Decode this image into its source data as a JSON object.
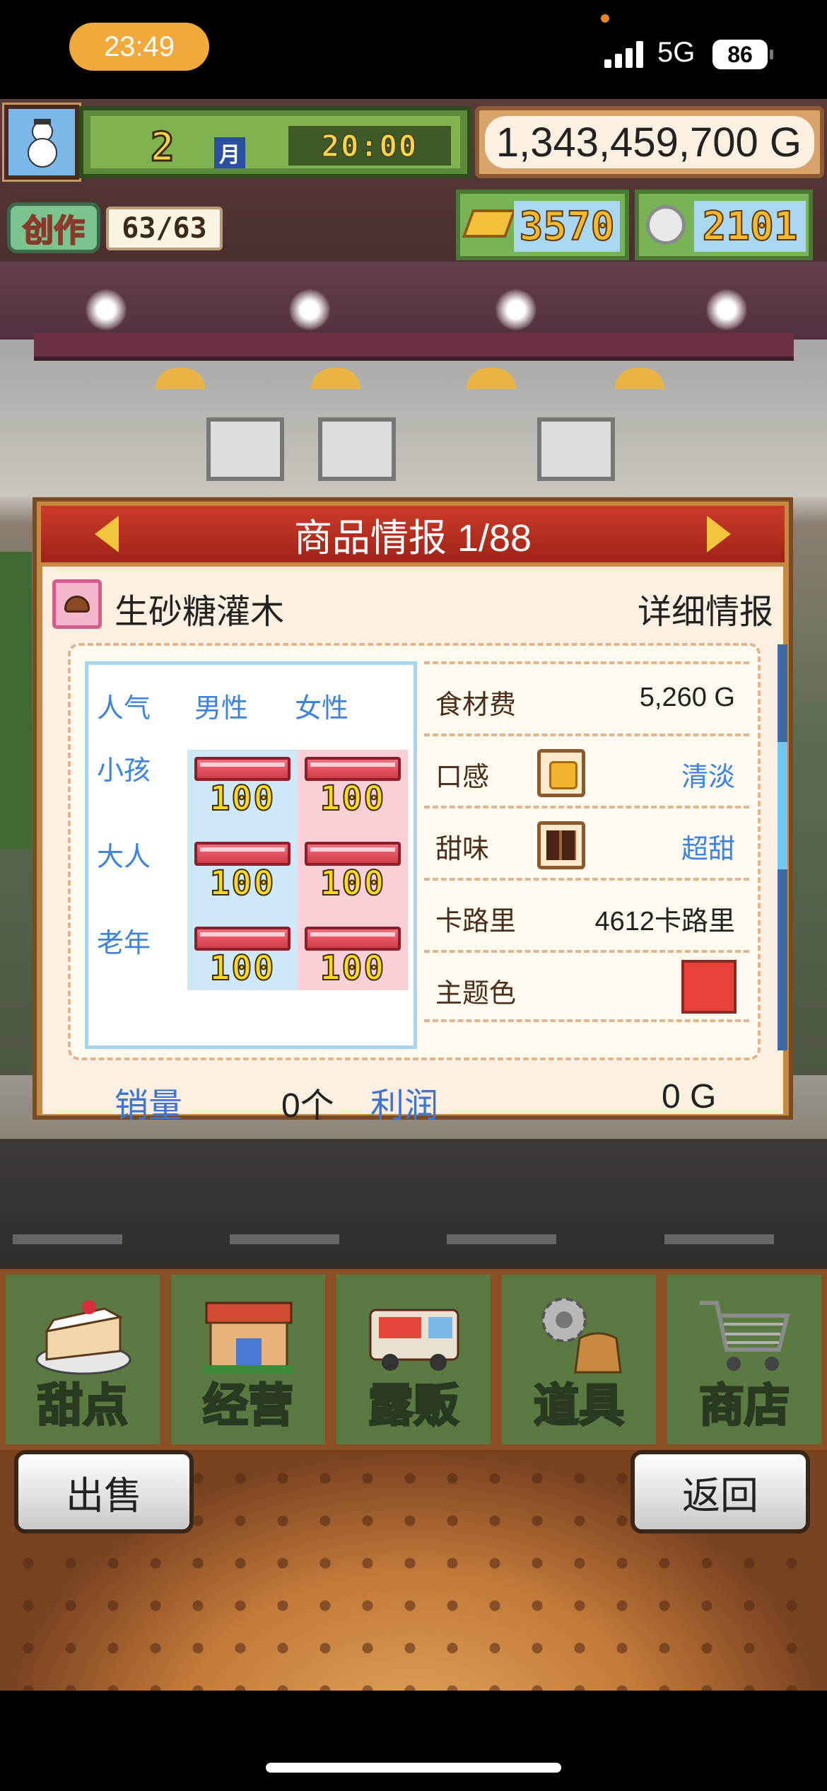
{
  "status_bar": {
    "time": "23:49",
    "network": "5G",
    "battery": "86"
  },
  "hud": {
    "month_number": "2",
    "month_unit": "月",
    "clock": "20:00",
    "money": "1,343,459,700 G",
    "create_label": "创作",
    "create_value": "63/63",
    "gold_bars": "3570",
    "silver_coins": "2101"
  },
  "panel": {
    "title": "商品情报 1/88",
    "item_name": "生砂糖灌木",
    "detail_button": "详细情报",
    "popularity": {
      "header": "人气",
      "col_male": "男性",
      "col_female": "女性",
      "rows": [
        {
          "label": "小孩",
          "male": "100",
          "female": "100"
        },
        {
          "label": "大人",
          "male": "100",
          "female": "100"
        },
        {
          "label": "老年",
          "male": "100",
          "female": "100"
        }
      ]
    },
    "attributes": {
      "ingredient_cost_label": "食材费",
      "ingredient_cost_value": "5,260 G",
      "texture_label": "口感",
      "texture_value": "清淡",
      "sweetness_label": "甜味",
      "sweetness_value": "超甜",
      "calories_label": "卡路里",
      "calories_value": "4612卡路里",
      "theme_color_label": "主题色",
      "theme_color": "#e8423a"
    },
    "stats": {
      "sales_label": "销量",
      "sales_value": "0个",
      "profit_label": "利润",
      "profit_value": "0 G"
    },
    "scroll_position": 0.35
  },
  "menu": {
    "items": [
      {
        "label": "甜点",
        "icon": "cake-icon"
      },
      {
        "label": "经营",
        "icon": "shop-icon"
      },
      {
        "label": "露贩",
        "icon": "food-truck-icon"
      },
      {
        "label": "道具",
        "icon": "gear-and-bag-icon"
      },
      {
        "label": "商店",
        "icon": "shopping-cart-icon"
      }
    ]
  },
  "actions": {
    "sell": "出售",
    "back": "返回"
  }
}
